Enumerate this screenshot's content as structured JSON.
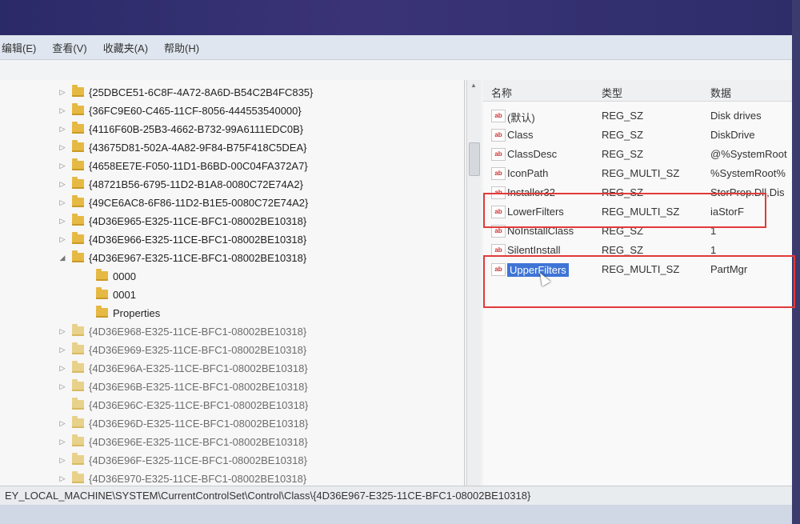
{
  "menu": {
    "items": [
      "编辑(E)",
      "查看(V)",
      "收藏夹(A)",
      "帮助(H)"
    ]
  },
  "tree": {
    "rows": [
      {
        "label": "{25DBCE51-6C8F-4A72-8A6D-B54C2B4FC835}",
        "expander": "▷",
        "indent": 0
      },
      {
        "label": "{36FC9E60-C465-11CF-8056-444553540000}",
        "expander": "▷",
        "indent": 0
      },
      {
        "label": "{4116F60B-25B3-4662-B732-99A6111EDC0B}",
        "expander": "▷",
        "indent": 0
      },
      {
        "label": "{43675D81-502A-4A82-9F84-B75F418C5DEA}",
        "expander": "▷",
        "indent": 0
      },
      {
        "label": "{4658EE7E-F050-11D1-B6BD-00C04FA372A7}",
        "expander": "▷",
        "indent": 0
      },
      {
        "label": "{48721B56-6795-11D2-B1A8-0080C72E74A2}",
        "expander": "▷",
        "indent": 0
      },
      {
        "label": "{49CE6AC8-6F86-11D2-B1E5-0080C72E74A2}",
        "expander": "▷",
        "indent": 0
      },
      {
        "label": "{4D36E965-E325-11CE-BFC1-08002BE10318}",
        "expander": "▷",
        "indent": 0
      },
      {
        "label": "{4D36E966-E325-11CE-BFC1-08002BE10318}",
        "expander": "▷",
        "indent": 0
      },
      {
        "label": "{4D36E967-E325-11CE-BFC1-08002BE10318}",
        "expander": "◢",
        "indent": 0
      },
      {
        "label": "0000",
        "expander": "",
        "indent": 1
      },
      {
        "label": "0001",
        "expander": "",
        "indent": 1
      },
      {
        "label": "Properties",
        "expander": "",
        "indent": 1
      },
      {
        "label": "{4D36E968-E325-11CE-BFC1-08002BE10318}",
        "expander": "▷",
        "indent": 0
      },
      {
        "label": "{4D36E969-E325-11CE-BFC1-08002BE10318}",
        "expander": "▷",
        "indent": 0
      },
      {
        "label": "{4D36E96A-E325-11CE-BFC1-08002BE10318}",
        "expander": "▷",
        "indent": 0
      },
      {
        "label": "{4D36E96B-E325-11CE-BFC1-08002BE10318}",
        "expander": "▷",
        "indent": 0
      },
      {
        "label": "{4D36E96C-E325-11CE-BFC1-08002BE10318}",
        "expander": "",
        "indent": 0
      },
      {
        "label": "{4D36E96D-E325-11CE-BFC1-08002BE10318}",
        "expander": "▷",
        "indent": 0
      },
      {
        "label": "{4D36E96E-E325-11CE-BFC1-08002BE10318}",
        "expander": "▷",
        "indent": 0
      },
      {
        "label": "{4D36E96F-E325-11CE-BFC1-08002BE10318}",
        "expander": "▷",
        "indent": 0
      },
      {
        "label": "{4D36E970-E325-11CE-BFC1-08002BE10318}",
        "expander": "▷",
        "indent": 0
      }
    ]
  },
  "values": {
    "headers": {
      "name": "名称",
      "type": "类型",
      "data": "数据"
    },
    "rows": [
      {
        "name": "(默认)",
        "type": "REG_SZ",
        "data": "Disk drives"
      },
      {
        "name": "Class",
        "type": "REG_SZ",
        "data": "DiskDrive"
      },
      {
        "name": "ClassDesc",
        "type": "REG_SZ",
        "data": "@%SystemRoot"
      },
      {
        "name": "IconPath",
        "type": "REG_MULTI_SZ",
        "data": "%SystemRoot%"
      },
      {
        "name": "Installer32",
        "type": "REG_SZ",
        "data": "StorProp.Dll,Dis"
      },
      {
        "name": "LowerFilters",
        "type": "REG_MULTI_SZ",
        "data": "iaStorF"
      },
      {
        "name": "NoInstallClass",
        "type": "REG_SZ",
        "data": "1"
      },
      {
        "name": "SilentInstall",
        "type": "REG_SZ",
        "data": "1"
      },
      {
        "name": "UpperFilters",
        "type": "REG_MULTI_SZ",
        "data": "PartMgr"
      }
    ],
    "selected_index": 8,
    "icon_text": "ab"
  },
  "status": {
    "path": "EY_LOCAL_MACHINE\\SYSTEM\\CurrentControlSet\\Control\\Class\\{4D36E967-E325-11CE-BFC1-08002BE10318}"
  },
  "colors": {
    "annotation": "#e23a3a",
    "selection": "#3f74d6",
    "folder": "#e5b943"
  }
}
